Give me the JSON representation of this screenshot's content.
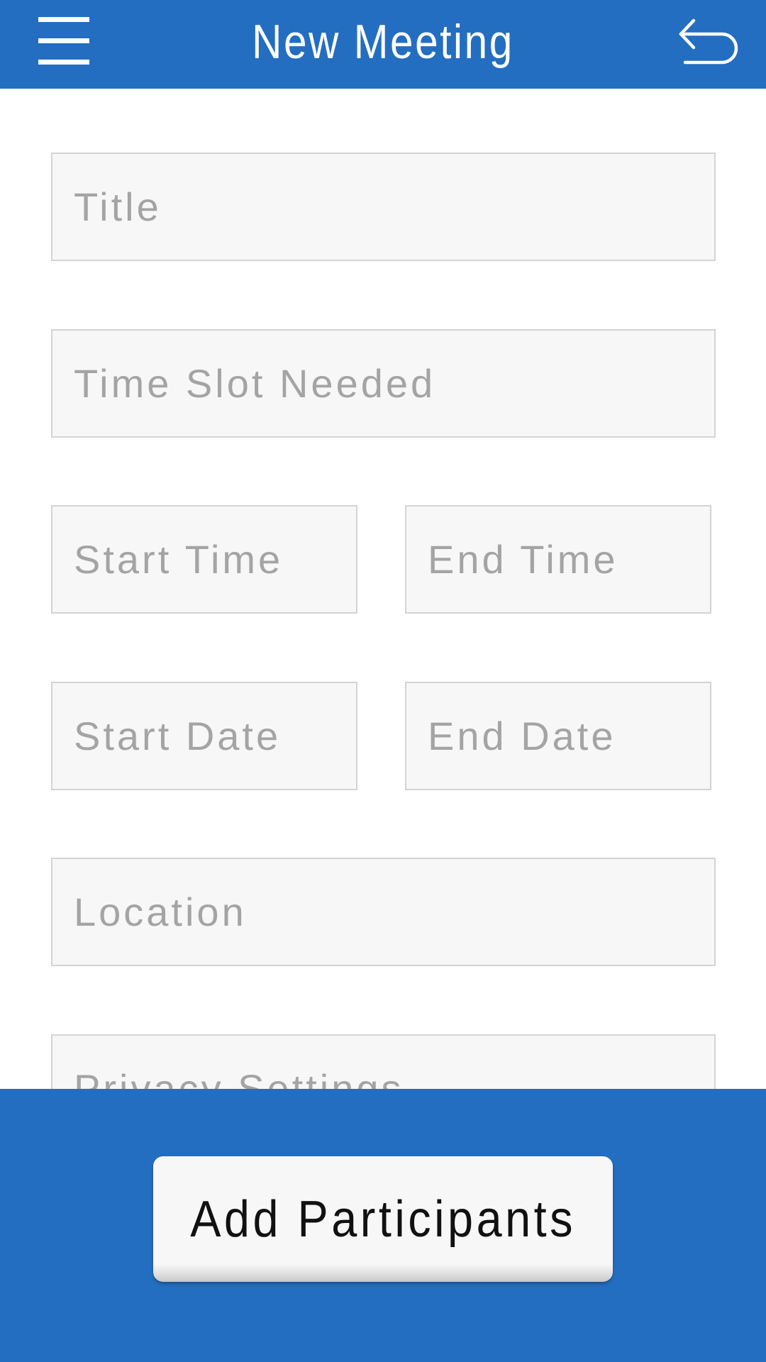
{
  "header": {
    "title": "New Meeting",
    "menu_icon": "hamburger-menu-icon",
    "back_icon": "undo-arrow-icon"
  },
  "form": {
    "title_placeholder": "Title",
    "time_slot_placeholder": "Time Slot Needed",
    "start_time_placeholder": "Start Time",
    "end_time_placeholder": "End Time",
    "start_date_placeholder": "Start Date",
    "end_date_placeholder": "End Date",
    "location_placeholder": "Location",
    "privacy_placeholder": "Privacy Settings"
  },
  "footer": {
    "add_participants_label": "Add Participants"
  },
  "colors": {
    "primary": "#236ec0",
    "field_background": "#f7f7f7",
    "field_border": "#d4d4d4",
    "placeholder_text": "#a4a4a4",
    "white": "#ffffff"
  }
}
